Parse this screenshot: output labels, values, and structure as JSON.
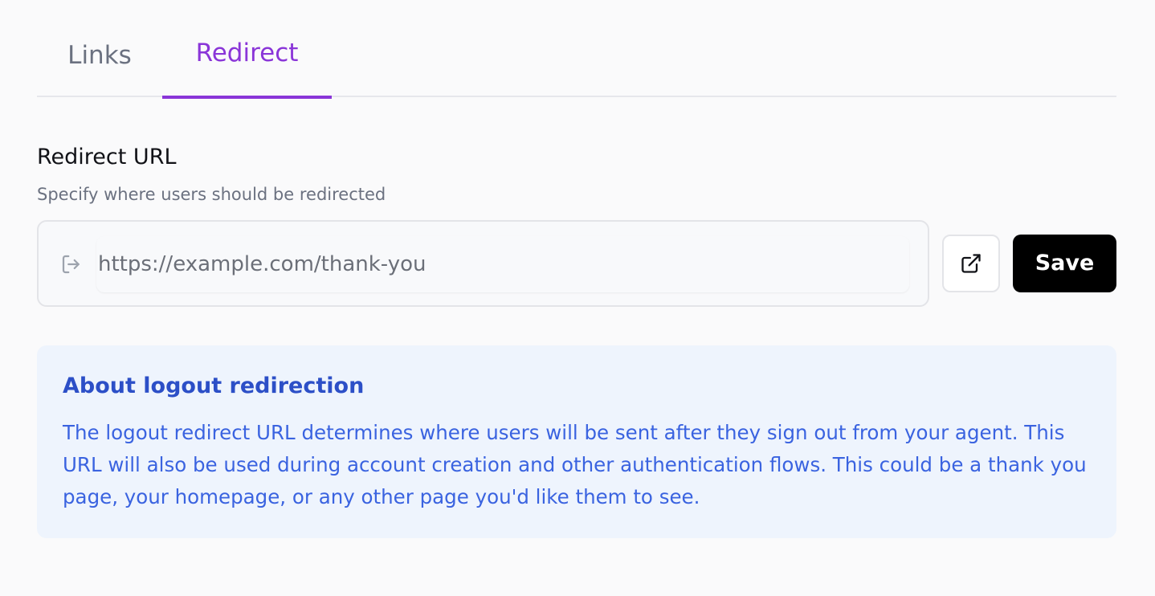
{
  "tabs": [
    {
      "label": "Links",
      "active": false
    },
    {
      "label": "Redirect",
      "active": true
    }
  ],
  "field": {
    "title": "Redirect URL",
    "description": "Specify where users should be redirected",
    "value": "https://example.com/thank-you",
    "input_icon": "sign-out-icon"
  },
  "actions": {
    "open_icon": "external-link-icon",
    "save_label": "Save"
  },
  "info": {
    "title": "About logout redirection",
    "body": "The logout redirect URL determines where users will be sent after they sign out from your agent. This URL will also be used during account creation and other authentication flows. This could be a thank you page, your homepage, or any other page you'd like them to see."
  },
  "colors": {
    "accent": "#8a35d8",
    "info_background": "#eef4fd",
    "info_text": "#3a63e0",
    "save_background": "#000000"
  }
}
